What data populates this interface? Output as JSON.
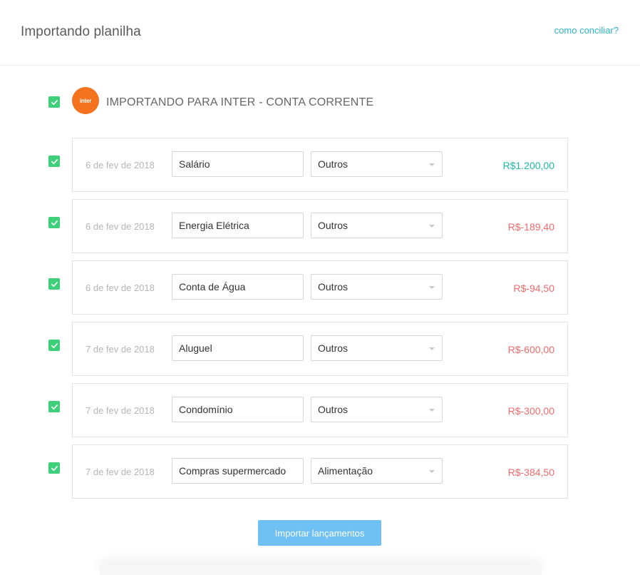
{
  "header": {
    "title": "Importando planilha",
    "help_link": "como conciliar?"
  },
  "account": {
    "logo_text": "inter",
    "label": "IMPORTANDO PARA INTER - CONTA CORRENTE",
    "logo_color": "#f5731f",
    "checked": true
  },
  "colors": {
    "positive": "#1fb9a6",
    "negative": "#f26b6b",
    "checkbox": "#3ecf7a",
    "button": "#6ec0f5"
  },
  "transactions": [
    {
      "date": "6 de fev de 2018",
      "description": "Salário",
      "category": "Outros",
      "amount": "R$1.200,00",
      "positive": true
    },
    {
      "date": "6 de fev de 2018",
      "description": "Energia Elétrica",
      "category": "Outros",
      "amount": "R$-189,40",
      "positive": false
    },
    {
      "date": "6 de fev de 2018",
      "description": "Conta de Água",
      "category": "Outros",
      "amount": "R$-94,50",
      "positive": false
    },
    {
      "date": "7 de fev de 2018",
      "description": "Aluguel",
      "category": "Outros",
      "amount": "R$-600,00",
      "positive": false
    },
    {
      "date": "7 de fev de 2018",
      "description": "Condomínio",
      "category": "Outros",
      "amount": "R$-300,00",
      "positive": false
    },
    {
      "date": "7 de fev de 2018",
      "description": "Compras supermercado",
      "category": "Alimentação",
      "amount": "R$-384,50",
      "positive": false
    }
  ],
  "footer": {
    "import_button": "Importar lançamentos"
  }
}
